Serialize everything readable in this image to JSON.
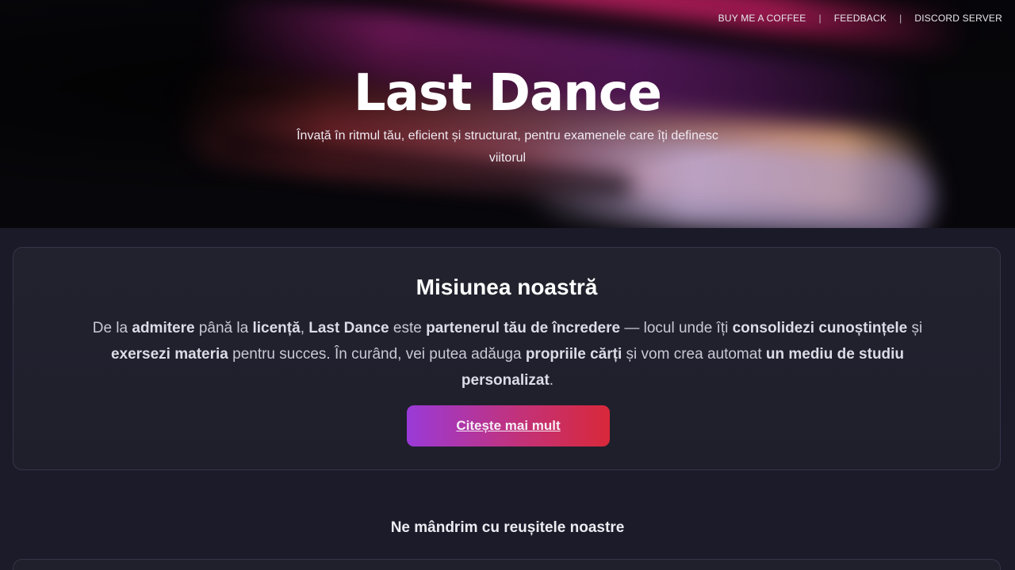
{
  "nav": {
    "items": [
      {
        "label": "BUY ME A COFFEE"
      },
      {
        "label": "FEEDBACK"
      },
      {
        "label": "DISCORD SERVER"
      }
    ],
    "separator": "|"
  },
  "hero": {
    "title": "Last Dance",
    "subtitle": "Învață în ritmul tău, eficient și structurat, pentru examenele care îți definesc viitorul"
  },
  "mission": {
    "title": "Misiunea noastră",
    "segments": [
      {
        "text": "De la ",
        "bold": false
      },
      {
        "text": "admitere",
        "bold": true
      },
      {
        "text": " până la ",
        "bold": false
      },
      {
        "text": "licență",
        "bold": true
      },
      {
        "text": ", ",
        "bold": false
      },
      {
        "text": "Last Dance",
        "bold": true
      },
      {
        "text": " este ",
        "bold": false
      },
      {
        "text": "partenerul tău de încredere",
        "bold": true
      },
      {
        "text": " — locul unde îți ",
        "bold": false
      },
      {
        "text": "consolidezi cunoștințele",
        "bold": true
      },
      {
        "text": " și ",
        "bold": false
      },
      {
        "text": "exersezi materia",
        "bold": true
      },
      {
        "text": " pentru succes. În curând, vei putea adăuga ",
        "bold": false
      },
      {
        "text": "propriile cărți",
        "bold": true
      },
      {
        "text": " și vom crea automat ",
        "bold": false
      },
      {
        "text": "un mediu de studiu personalizat",
        "bold": true
      },
      {
        "text": ".",
        "bold": false
      }
    ],
    "cta_label": "Citește mai mult"
  },
  "achievements": {
    "heading": "Ne mândrim cu reușitele noastre"
  },
  "colors": {
    "background": "#1a1a28",
    "card": "#20202d",
    "cta_gradient_start": "#9a3ad8",
    "cta_gradient_end": "#d8283a"
  }
}
